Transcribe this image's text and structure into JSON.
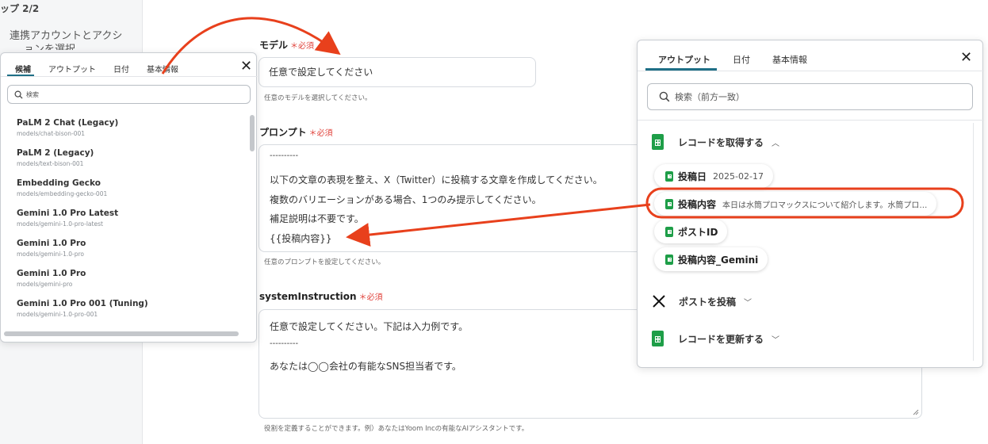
{
  "sidebar": {
    "step_label": "ップ 2/2",
    "nav_item": "連携アカウントとアクシ",
    "nav_item_cont": "ョンを選択"
  },
  "form": {
    "model": {
      "label": "モデル",
      "required": "＊必須",
      "value": "任意で設定してください",
      "help": "任意のモデルを選択してください。"
    },
    "prompt": {
      "label": "プロンプト",
      "required": "＊必須",
      "lines": [
        "----------",
        "以下の文章の表現を整え、X（Twitter）に投稿する文章を作成してください。",
        "複数のバリエーションがある場合、1つのみ提示してください。",
        "補足説明は不要です。",
        "{{投稿内容}}"
      ],
      "help": "任意のプロンプトを設定してください。"
    },
    "system": {
      "label": "systemInstruction",
      "required": "＊必須",
      "lines": [
        "任意で設定してください。下記は入力例です。",
        "----------",
        "あなたは◯◯会社の有能なSNS担当者です。"
      ],
      "help": "役割を定義することができます。例）あなたはYoom Incの有能なAIアシスタントです。"
    }
  },
  "left_panel": {
    "tabs": [
      "候補",
      "アウトプット",
      "日付",
      "基本情報"
    ],
    "active_tab": "候補",
    "close": "✕",
    "search_placeholder": "検索",
    "models": [
      {
        "name": "PaLM 2 Chat (Legacy)",
        "id": "models/chat-bison-001"
      },
      {
        "name": "PaLM 2 (Legacy)",
        "id": "models/text-bison-001"
      },
      {
        "name": "Embedding Gecko",
        "id": "models/embedding-gecko-001"
      },
      {
        "name": "Gemini 1.0 Pro Latest",
        "id": "models/gemini-1.0-pro-latest"
      },
      {
        "name": "Gemini 1.0 Pro",
        "id": "models/gemini-1.0-pro"
      },
      {
        "name": "Gemini 1.0 Pro",
        "id": "models/gemini-pro"
      },
      {
        "name": "Gemini 1.0 Pro 001 (Tuning)",
        "id": "models/gemini-1.0-pro-001"
      }
    ]
  },
  "right_panel": {
    "tabs": [
      "アウトプット",
      "日付",
      "基本情報"
    ],
    "active_tab": "アウトプット",
    "close": "✕",
    "search_placeholder": "検索（前方一致）",
    "sections": [
      {
        "title": "レコードを取得する",
        "expanded": true
      },
      {
        "title": "ポストを投稿",
        "expanded": false
      },
      {
        "title": "レコードを更新する",
        "expanded": false
      }
    ],
    "items": [
      {
        "key": "投稿日",
        "value": "2025-02-17"
      },
      {
        "key": "投稿内容",
        "value": "本日は水筒プロマックスについて紹介します。水筒プロ…"
      },
      {
        "key": "ポストID",
        "value": ""
      },
      {
        "key": "投稿内容_Gemini",
        "value": ""
      }
    ]
  },
  "colors": {
    "required": "#e0413a",
    "sheets_green": "#1e9e48",
    "arrow": "#e8401c",
    "tab_underline": "#1f6f86"
  }
}
